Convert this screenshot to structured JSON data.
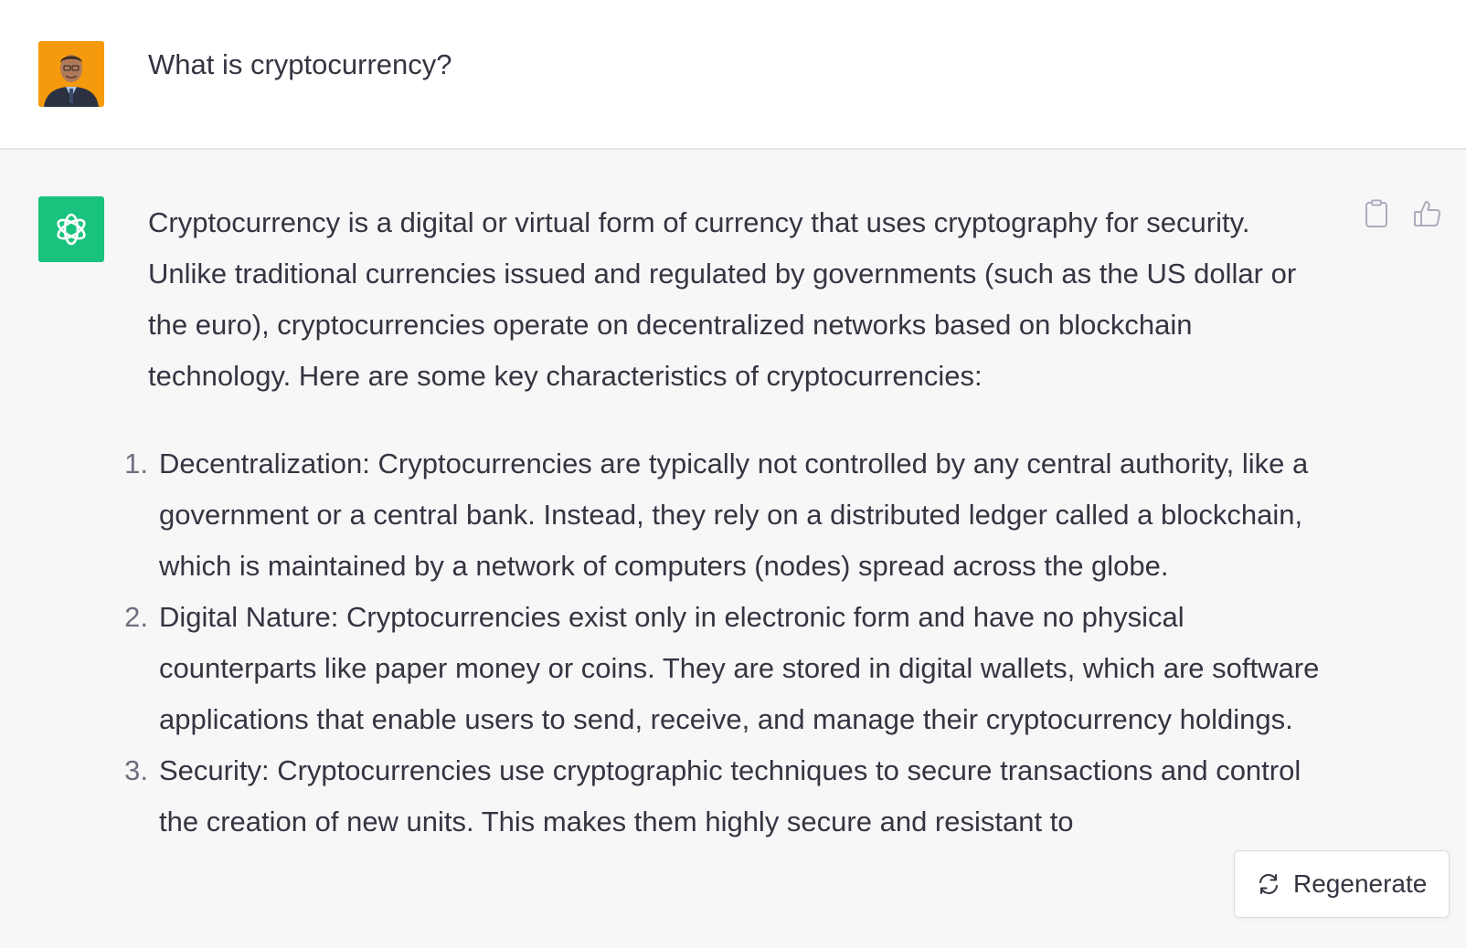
{
  "conversation": {
    "user_message": "What is cryptocurrency?",
    "assistant": {
      "intro": "Cryptocurrency is a digital or virtual form of currency that uses cryptography for security. Unlike traditional currencies issued and regulated by governments (such as the US dollar or the euro), cryptocurrencies operate on decentralized networks based on blockchain technology. Here are some key characteristics of cryptocurrencies:",
      "items": [
        {
          "number": "1.",
          "text": "Decentralization: Cryptocurrencies are typically not controlled by any central authority, like a government or a central bank. Instead, they rely on a distributed ledger called a blockchain, which is maintained by a network of computers (nodes) spread across the globe."
        },
        {
          "number": "2.",
          "text": "Digital Nature: Cryptocurrencies exist only in electronic form and have no physical counterparts like paper money or coins. They are stored in digital wallets, which are software applications that enable users to send, receive, and manage their cryptocurrency holdings."
        },
        {
          "number": "3.",
          "text": "Security: Cryptocurrencies use cryptographic techniques to secure transactions and control the creation of new units. This makes them highly secure and resistant to"
        }
      ]
    }
  },
  "actions": {
    "copy_icon": "clipboard-icon",
    "like_icon": "thumbs-up-icon",
    "regenerate_label": "Regenerate",
    "regenerate_icon": "refresh-icon"
  },
  "colors": {
    "assistant_avatar": "#19c37d",
    "user_avatar_bg": "#f59a0c",
    "text": "#343541",
    "muted": "#6e6e80",
    "assistant_bg": "#f7f7f8"
  }
}
